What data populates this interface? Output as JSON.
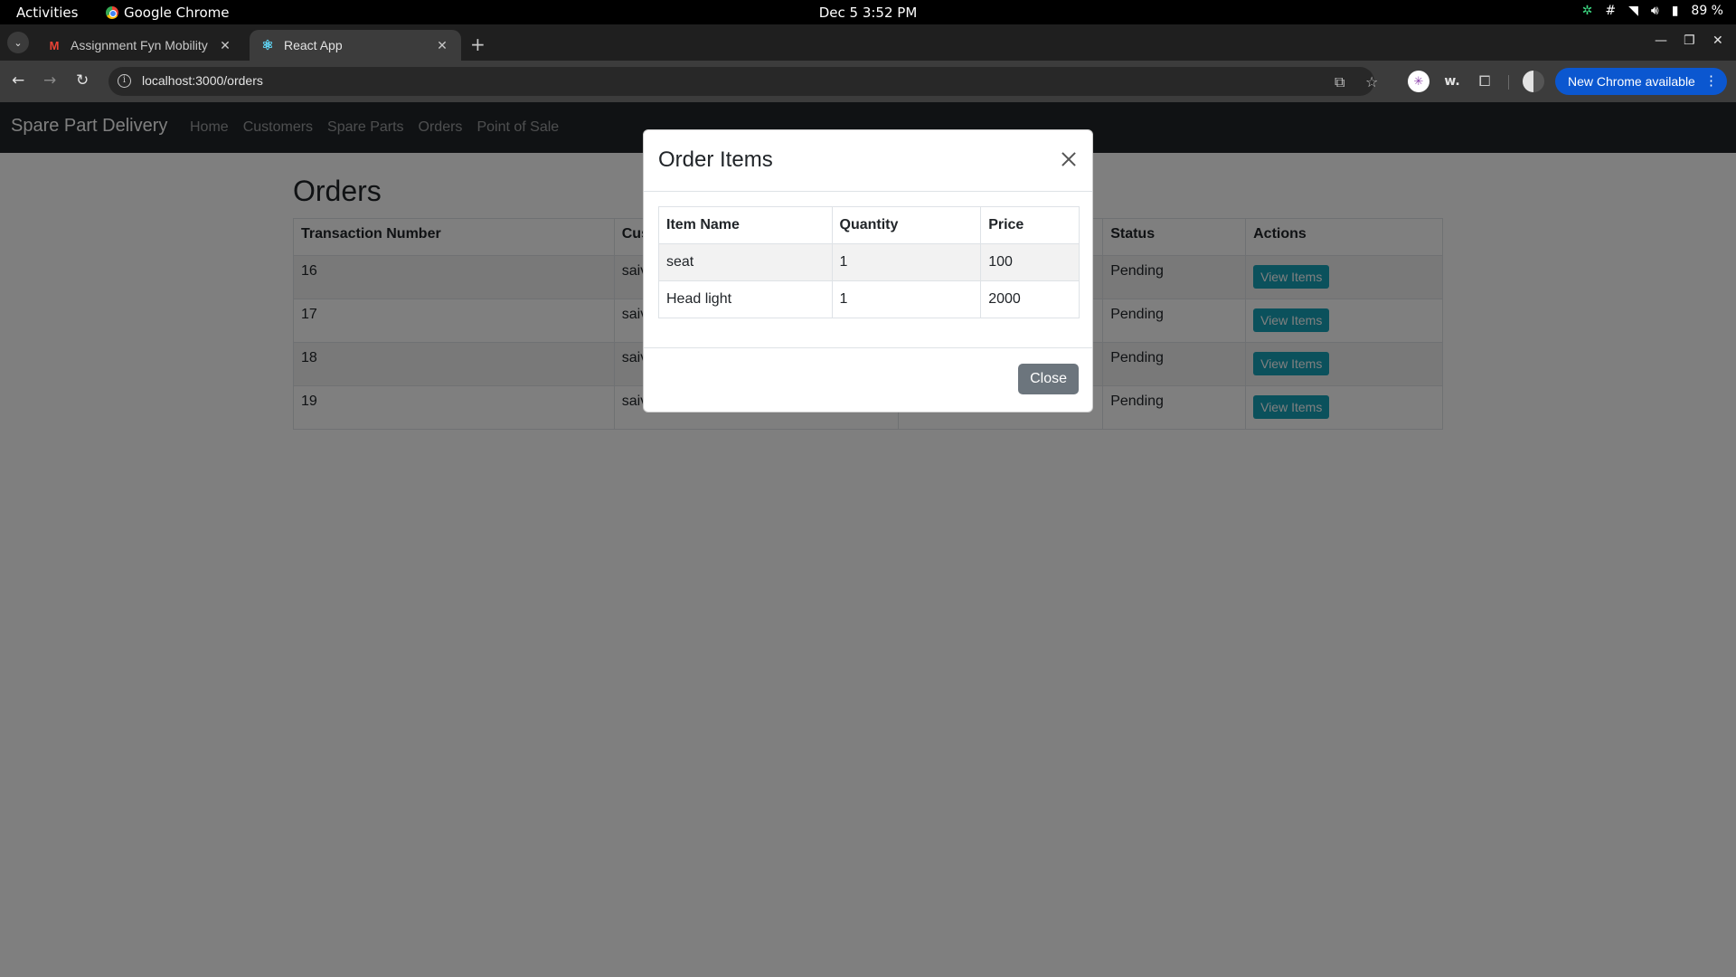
{
  "system_bar": {
    "activities": "Activities",
    "app_name": "Google Chrome",
    "clock": "Dec 5  3:52 PM",
    "battery": "89 %"
  },
  "browser": {
    "tabs": [
      {
        "title": "Assignment Fyn Mobility",
        "favicon": "gmail-icon",
        "active": false
      },
      {
        "title": "React App",
        "favicon": "react-icon",
        "active": true
      }
    ],
    "url": "localhost:3000/orders",
    "update_label": "New Chrome available",
    "extension_w_label": "w."
  },
  "app": {
    "brand": "Spare Part Delivery",
    "nav": [
      "Home",
      "Customers",
      "Spare Parts",
      "Orders",
      "Point of Sale"
    ],
    "page_title": "Orders",
    "orders_table": {
      "headers": [
        "Transaction Number",
        "Cus",
        "",
        "Status",
        "Actions"
      ],
      "rows": [
        {
          "transaction": "16",
          "customer": "saiv",
          "status": "Pending",
          "action": "View Items"
        },
        {
          "transaction": "17",
          "customer": "saiv",
          "status": "Pending",
          "action": "View Items"
        },
        {
          "transaction": "18",
          "customer": "saiv",
          "status": "Pending",
          "action": "View Items"
        },
        {
          "transaction": "19",
          "customer": "saiv",
          "status": "Pending",
          "action": "View Items"
        }
      ]
    }
  },
  "modal": {
    "title": "Order Items",
    "headers": [
      "Item Name",
      "Quantity",
      "Price"
    ],
    "rows": [
      {
        "name": "seat",
        "quantity": "1",
        "price": "100"
      },
      {
        "name": "Head light",
        "quantity": "1",
        "price": "2000"
      }
    ],
    "close_label": "Close"
  },
  "colors": {
    "navbar": "#212529",
    "view_button": "#17a2b8",
    "close_button": "#6c757d",
    "update_button": "#0b57d0"
  }
}
